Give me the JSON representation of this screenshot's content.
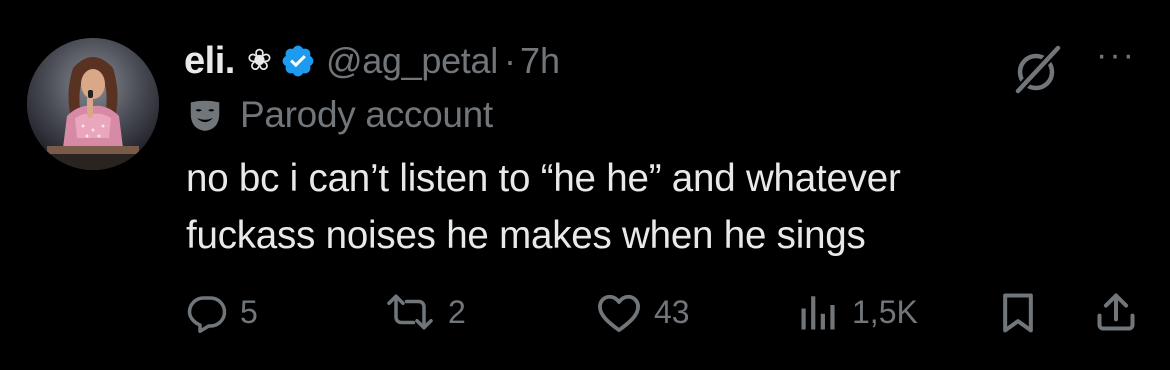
{
  "tweet": {
    "display_name": "eli.",
    "name_glyph": "❀",
    "handle": "@ag_petal",
    "separator": "·",
    "time": "7h",
    "parody_label": "Parody account",
    "text_lines": [
      "no bc i can’t listen to “he he” and whatever",
      "fuckass noises he makes when he sings"
    ],
    "more_glyph": "···"
  },
  "metrics": {
    "replies": "5",
    "reposts": "2",
    "likes": "43",
    "views": "1,5K"
  },
  "icons": {
    "avatar": "avatar-photo",
    "flower": "flower-icon",
    "verified": "verified-badge-icon",
    "grok": "grok-icon",
    "more": "more-icon",
    "parody": "parody-mask-icon",
    "reply": "reply-icon",
    "repost": "repost-icon",
    "like": "heart-icon",
    "views": "views-icon",
    "bookmark": "bookmark-icon",
    "share": "share-icon"
  },
  "colors": {
    "background": "#000000",
    "text_primary": "#e7e9ea",
    "text_secondary": "#71767b",
    "verified_blue": "#1d9bf0"
  }
}
